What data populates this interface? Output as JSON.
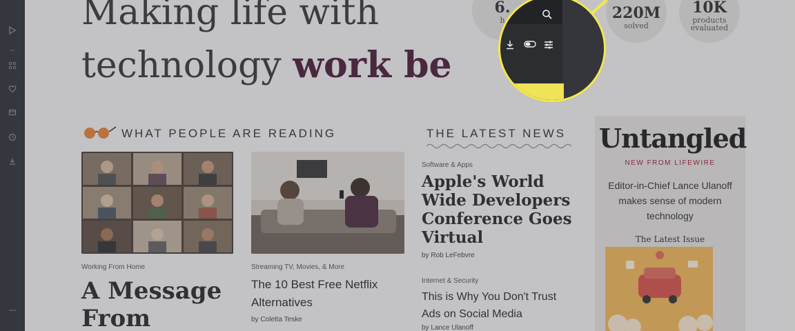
{
  "hero": {
    "line1": "Making life with",
    "line2_plain": "technology ",
    "line2_bold": "work be"
  },
  "stats": [
    {
      "big": "6.",
      "small": "h"
    },
    {
      "big": "220M",
      "small": "solved"
    },
    {
      "big": "10K",
      "small": "products evaluated"
    }
  ],
  "sections": {
    "reading_title": "WHAT PEOPLE ARE READING",
    "news_title": "THE LATEST NEWS"
  },
  "cards": [
    {
      "kicker": "Working From Home",
      "title": "A Message From"
    },
    {
      "kicker": "Streaming TV, Movies, & More",
      "title": "The 10 Best Free Netflix Alternatives",
      "byline": "by Coletta Teske"
    }
  ],
  "news": [
    {
      "kicker": "Software & Apps",
      "title_lines": [
        "Apple's World",
        "Wide Developers",
        "Conference Goes",
        "Virtual"
      ],
      "byline": "by Rob LeFebvre"
    },
    {
      "kicker": "Internet & Security",
      "title_lines": [
        "This is Why You Don't Trust",
        "Ads on Social Media"
      ],
      "byline": "by Lance Ulanoff"
    }
  ],
  "promo": {
    "logo": "Untangled",
    "sub": "NEW FROM LIFEWIRE",
    "desc": "Editor-in-Chief Lance Ulanoff makes sense of modern technology",
    "issue": "The Latest Issue"
  },
  "icons": {
    "sidebar": [
      "play-icon",
      "grid-icon",
      "heart-icon",
      "wallet-icon",
      "clock-icon",
      "download-icon",
      "more-icon"
    ],
    "magnifier": [
      "search-icon",
      "download-icon",
      "toggle-icon",
      "sliders-icon"
    ]
  },
  "colors": {
    "accent_bold": "#4b1f3a",
    "magnifier_ring": "#f2e84a",
    "sidebar_bg": "#2f3236"
  }
}
